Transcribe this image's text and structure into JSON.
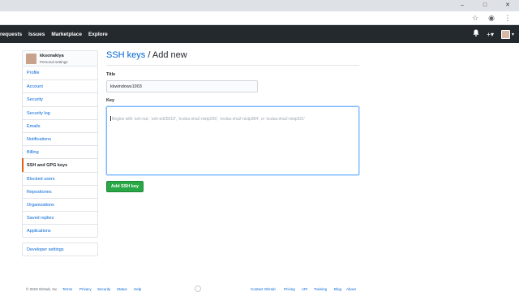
{
  "browser": {
    "window_controls": [
      "–",
      "□",
      "✕"
    ],
    "toolbar_icons": [
      "star-icon",
      "extension-icon",
      "menu-icon"
    ]
  },
  "header": {
    "nav": [
      "requests",
      "Issues",
      "Marketplace",
      "Explore"
    ]
  },
  "sidebar": {
    "user_name": "kksonakiya",
    "user_sub": "Personal settings",
    "items": [
      {
        "label": "Profile"
      },
      {
        "label": "Account"
      },
      {
        "label": "Security"
      },
      {
        "label": "Security log"
      },
      {
        "label": "Emails"
      },
      {
        "label": "Notifications"
      },
      {
        "label": "Billing"
      },
      {
        "label": "SSH and GPG keys"
      },
      {
        "label": "Blocked users"
      },
      {
        "label": "Repositories"
      },
      {
        "label": "Organizations"
      },
      {
        "label": "Saved replies"
      },
      {
        "label": "Applications"
      }
    ],
    "selected_index": 7,
    "developer_settings": "Developer settings"
  },
  "main": {
    "breadcrumb_link": "SSH keys",
    "breadcrumb_rest": " / Add new",
    "title_label": "Title",
    "title_value": "kkwindows1903",
    "key_label": "Key",
    "key_placeholder": "Begins with 'ssh-rsa', 'ssh-ed25519', 'ecdsa-sha2-nistp256', 'ecdsa-sha2-nistp384', or 'ecdsa-sha2-nistp521'",
    "add_button": "Add SSH key"
  },
  "footer": {
    "copyright": "© 2019 GitHub, Inc.",
    "left_links": [
      "Terms",
      "Privacy",
      "Security",
      "Status",
      "Help"
    ],
    "right_links": [
      "Contact GitHub",
      "Pricing",
      "API",
      "Training",
      "Blog",
      "About"
    ]
  },
  "colors": {
    "header_bg": "#24292e",
    "link": "#0366d6",
    "button_green": "#28a745",
    "selected_accent": "#e36209",
    "focus_border": "#79b8ff"
  }
}
